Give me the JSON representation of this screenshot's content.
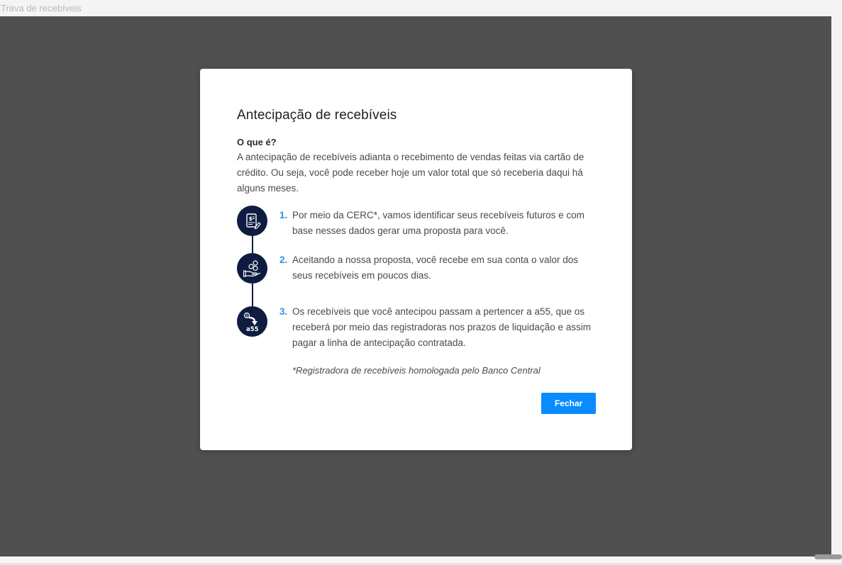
{
  "page": {
    "label": "Trava de recebíveis"
  },
  "modal": {
    "title": "Antecipação de recebíveis",
    "question": "O que é?",
    "intro": "A antecipação de recebíveis adianta o recebimento de vendas feitas via cartão de crédito. Ou seja, você pode receber hoje um valor total que só receberia daqui há alguns meses.",
    "steps": [
      {
        "number": "1.",
        "text": "Por meio da CERC*, vamos identificar seus recebíveis futuros e com base nesses dados gerar uma proposta para você.",
        "icon": "receipt-icon"
      },
      {
        "number": "2.",
        "text": "Aceitando a nossa proposta, você recebe em sua conta o valor dos seus recebíveis em poucos dias.",
        "icon": "hand-coins-icon"
      },
      {
        "number": "3.",
        "text": "Os recebíveis que você antecipou passam a pertencer a a55, que os receberá por meio das registradoras nos prazos de liquidação e assim pagar a linha de antecipação contratada.",
        "icon": "a55-transfer-icon",
        "icon_text": "a55"
      }
    ],
    "footnote": "*Registradora de recebíveis homologada pelo Banco Central",
    "close_label": "Fechar"
  },
  "colors": {
    "overlay": "#505050",
    "icon_bg": "#0d1c40",
    "step_number": "#2f8fe8",
    "button": "#0a8cff"
  }
}
